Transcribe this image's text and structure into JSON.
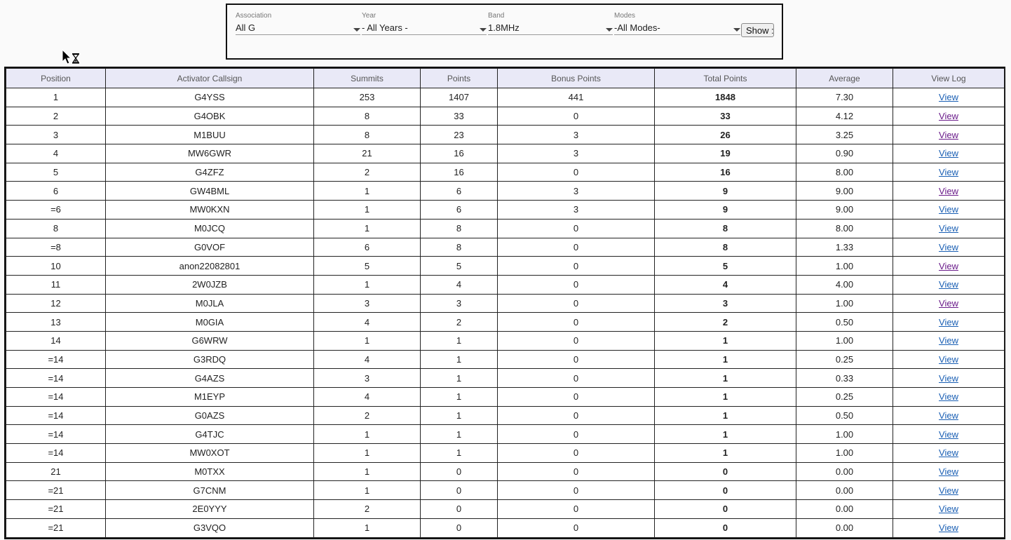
{
  "filters": {
    "association": {
      "label": "Association",
      "value": "All G"
    },
    "year": {
      "label": "Year",
      "value": "- All Years -"
    },
    "band": {
      "label": "Band",
      "value": "1.8MHz"
    },
    "modes": {
      "label": "Modes",
      "value": "-All Modes-"
    },
    "show_label": "Show",
    "trailing": ":"
  },
  "table": {
    "columns": [
      "Position",
      "Activator Callsign",
      "Summits",
      "Points",
      "Bonus Points",
      "Total Points",
      "Average",
      "View Log"
    ],
    "rows": [
      {
        "position": "1",
        "callsign": "G4YSS",
        "summits": "253",
        "points": "1407",
        "bonus": "441",
        "total": "1848",
        "average": "7.30",
        "log": "View",
        "visited": false
      },
      {
        "position": "2",
        "callsign": "G4OBK",
        "summits": "8",
        "points": "33",
        "bonus": "0",
        "total": "33",
        "average": "4.12",
        "log": "View",
        "visited": true
      },
      {
        "position": "3",
        "callsign": "M1BUU",
        "summits": "8",
        "points": "23",
        "bonus": "3",
        "total": "26",
        "average": "3.25",
        "log": "View",
        "visited": true
      },
      {
        "position": "4",
        "callsign": "MW6GWR",
        "summits": "21",
        "points": "16",
        "bonus": "3",
        "total": "19",
        "average": "0.90",
        "log": "View",
        "visited": false
      },
      {
        "position": "5",
        "callsign": "G4ZFZ",
        "summits": "2",
        "points": "16",
        "bonus": "0",
        "total": "16",
        "average": "8.00",
        "log": "View",
        "visited": false
      },
      {
        "position": "6",
        "callsign": "GW4BML",
        "summits": "1",
        "points": "6",
        "bonus": "3",
        "total": "9",
        "average": "9.00",
        "log": "View",
        "visited": true
      },
      {
        "position": "=6",
        "callsign": "MW0KXN",
        "summits": "1",
        "points": "6",
        "bonus": "3",
        "total": "9",
        "average": "9.00",
        "log": "View",
        "visited": false
      },
      {
        "position": "8",
        "callsign": "M0JCQ",
        "summits": "1",
        "points": "8",
        "bonus": "0",
        "total": "8",
        "average": "8.00",
        "log": "View",
        "visited": false
      },
      {
        "position": "=8",
        "callsign": "G0VOF",
        "summits": "6",
        "points": "8",
        "bonus": "0",
        "total": "8",
        "average": "1.33",
        "log": "View",
        "visited": false
      },
      {
        "position": "10",
        "callsign": "anon22082801",
        "summits": "5",
        "points": "5",
        "bonus": "0",
        "total": "5",
        "average": "1.00",
        "log": "View",
        "visited": true
      },
      {
        "position": "11",
        "callsign": "2W0JZB",
        "summits": "1",
        "points": "4",
        "bonus": "0",
        "total": "4",
        "average": "4.00",
        "log": "View",
        "visited": false
      },
      {
        "position": "12",
        "callsign": "M0JLA",
        "summits": "3",
        "points": "3",
        "bonus": "0",
        "total": "3",
        "average": "1.00",
        "log": "View",
        "visited": true
      },
      {
        "position": "13",
        "callsign": "M0GIA",
        "summits": "4",
        "points": "2",
        "bonus": "0",
        "total": "2",
        "average": "0.50",
        "log": "View",
        "visited": false
      },
      {
        "position": "14",
        "callsign": "G6WRW",
        "summits": "1",
        "points": "1",
        "bonus": "0",
        "total": "1",
        "average": "1.00",
        "log": "View",
        "visited": false
      },
      {
        "position": "=14",
        "callsign": "G3RDQ",
        "summits": "4",
        "points": "1",
        "bonus": "0",
        "total": "1",
        "average": "0.25",
        "log": "View",
        "visited": false
      },
      {
        "position": "=14",
        "callsign": "G4AZS",
        "summits": "3",
        "points": "1",
        "bonus": "0",
        "total": "1",
        "average": "0.33",
        "log": "View",
        "visited": false
      },
      {
        "position": "=14",
        "callsign": "M1EYP",
        "summits": "4",
        "points": "1",
        "bonus": "0",
        "total": "1",
        "average": "0.25",
        "log": "View",
        "visited": false
      },
      {
        "position": "=14",
        "callsign": "G0AZS",
        "summits": "2",
        "points": "1",
        "bonus": "0",
        "total": "1",
        "average": "0.50",
        "log": "View",
        "visited": false
      },
      {
        "position": "=14",
        "callsign": "G4TJC",
        "summits": "1",
        "points": "1",
        "bonus": "0",
        "total": "1",
        "average": "1.00",
        "log": "View",
        "visited": false
      },
      {
        "position": "=14",
        "callsign": "MW0XOT",
        "summits": "1",
        "points": "1",
        "bonus": "0",
        "total": "1",
        "average": "1.00",
        "log": "View",
        "visited": false
      },
      {
        "position": "21",
        "callsign": "M0TXX",
        "summits": "1",
        "points": "0",
        "bonus": "0",
        "total": "0",
        "average": "0.00",
        "log": "View",
        "visited": false
      },
      {
        "position": "=21",
        "callsign": "G7CNM",
        "summits": "1",
        "points": "0",
        "bonus": "0",
        "total": "0",
        "average": "0.00",
        "log": "View",
        "visited": false
      },
      {
        "position": "=21",
        "callsign": "2E0YYY",
        "summits": "2",
        "points": "0",
        "bonus": "0",
        "total": "0",
        "average": "0.00",
        "log": "View",
        "visited": false
      },
      {
        "position": "=21",
        "callsign": "G3VQO",
        "summits": "1",
        "points": "0",
        "bonus": "0",
        "total": "0",
        "average": "0.00",
        "log": "View",
        "visited": false
      }
    ]
  },
  "colors": {
    "link": "#1a5fb4",
    "visited_link": "#6a1b8a",
    "header_bg": "#e9e9f7"
  },
  "cursor": {
    "icon": "arrow-busy-cursor-icon"
  }
}
